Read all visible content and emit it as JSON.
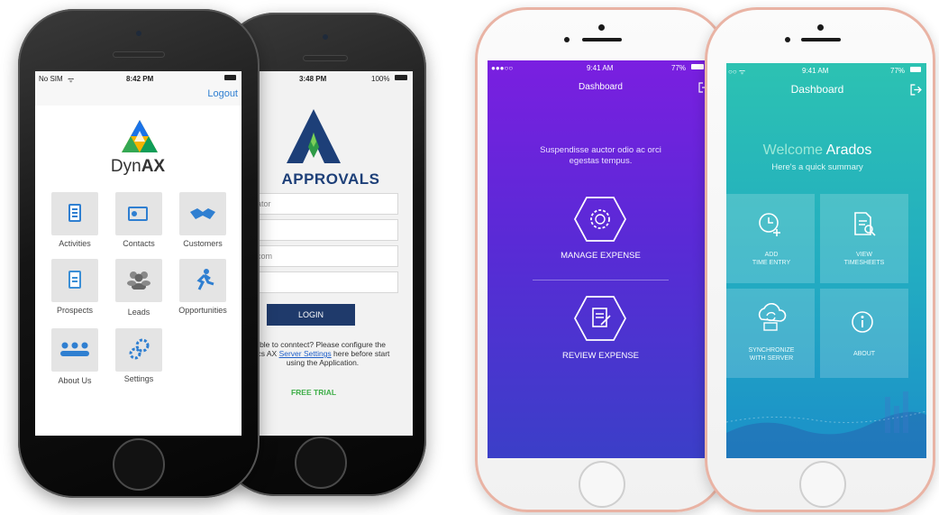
{
  "phone1": {
    "status": {
      "carrier": "No SIM",
      "time": "8:42 PM"
    },
    "logout": "Logout",
    "logo_text_prefix": "Dyn",
    "logo_text_suffix": "AX",
    "menu": [
      {
        "label": "Activities",
        "icon": "clipboard-icon"
      },
      {
        "label": "Contacts",
        "icon": "contact-card-icon"
      },
      {
        "label": "Customers",
        "icon": "handshake-icon"
      },
      {
        "label": "Prospects",
        "icon": "document-icon"
      },
      {
        "label": "Leads",
        "icon": "people-group-icon"
      },
      {
        "label": "Opportunities",
        "icon": "running-person-icon"
      },
      {
        "label": "About Us",
        "icon": "team-icon"
      },
      {
        "label": "Settings",
        "icon": "gears-icon"
      }
    ],
    "colors": {
      "accent": "#2f7fd1"
    }
  },
  "phone2": {
    "status": {
      "time": "3:48 PM",
      "battery": "100%"
    },
    "brand": "APPROVALS",
    "fields": [
      "istrator",
      "ord",
      "so.com",
      ""
    ],
    "login_label": "LOGIN",
    "help_line1": "ble to conntect? Please configure the",
    "help_line2_prefix": "ics AX ",
    "help_link": "Server Settings",
    "help_line2_suffix": " here before start",
    "help_line3": "using the Application.",
    "free_trial": "FREE TRIAL",
    "colors": {
      "login_bg": "#1f3a6b",
      "free_trial": "#3fae49",
      "brand": "#1d3f78"
    }
  },
  "phone3": {
    "status": {
      "time": "9:41 AM",
      "battery": "77%"
    },
    "title": "Dashboard",
    "tagline_line1": "Suspendisse auctor odio ac orci",
    "tagline_line2": "egestas tempus.",
    "actions": [
      {
        "label": "MANAGE EXPENSE",
        "icon": "gear-coin-icon"
      },
      {
        "label": "REVIEW EXPENSE",
        "icon": "document-edit-icon"
      }
    ],
    "colors": {
      "gradient_top": "#7a1fe0",
      "gradient_bottom": "#3b3fc8"
    }
  },
  "phone4": {
    "status": {
      "time": "9:41 AM",
      "battery": "77%"
    },
    "title": "Dashboard",
    "welcome_prefix": "Welcome ",
    "welcome_name": "Arados",
    "subtitle": "Here's a quick summary",
    "tiles": [
      {
        "line1": "ADD",
        "line2": "TIME ENTRY",
        "icon": "clock-plus-icon"
      },
      {
        "line1": "VIEW",
        "line2": "TIMESHEETS",
        "icon": "document-search-icon"
      },
      {
        "line1": "SYNCHRONIZE",
        "line2": "WITH SERVER",
        "icon": "cloud-sync-icon"
      },
      {
        "line1": "",
        "line2": "ABOUT",
        "icon": "info-icon"
      }
    ],
    "colors": {
      "gradient_top": "#2cc2b2",
      "gradient_bottom": "#1b8fc9"
    }
  }
}
